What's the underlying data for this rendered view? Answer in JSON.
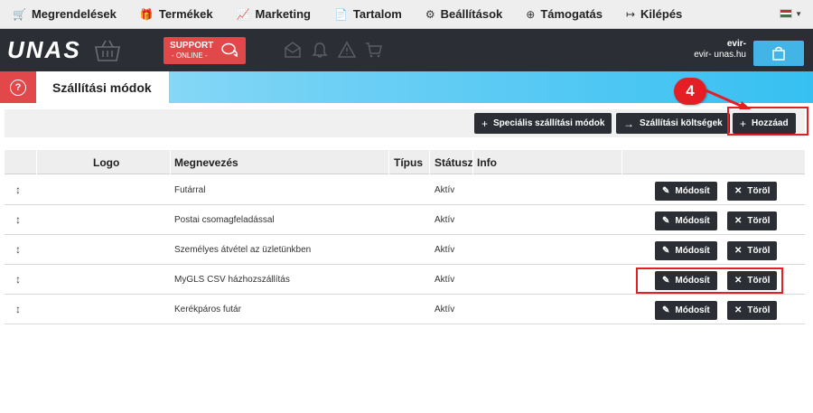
{
  "topmenu": {
    "items": [
      {
        "icon": "shopping-cart-icon",
        "glyph": "🛒",
        "label": "Megrendelések"
      },
      {
        "icon": "gift-icon",
        "glyph": "🎁",
        "label": "Termékek"
      },
      {
        "icon": "chart-line-icon",
        "glyph": "📈",
        "label": "Marketing"
      },
      {
        "icon": "document-icon",
        "glyph": "📄",
        "label": "Tartalom"
      },
      {
        "icon": "gear-icon",
        "glyph": "⚙",
        "label": "Beállítások"
      },
      {
        "icon": "lifebuoy-icon",
        "glyph": "⊕",
        "label": "Támogatás"
      },
      {
        "icon": "logout-icon",
        "glyph": "↦",
        "label": "Kilépés"
      }
    ],
    "language_flag": "hungarian-flag-icon"
  },
  "header": {
    "logo": "UNAS",
    "support_title": "SUPPORT",
    "support_subtitle": "- ONLINE -",
    "user_name": "evir-",
    "user_domain": "evir-        unas.hu"
  },
  "page": {
    "title": "Szállítási módok",
    "help_glyph": "?"
  },
  "toolbar": {
    "special_label": "Speciális szállítási módok",
    "costs_label": "Szállítási költségek",
    "add_label": "Hozzáad"
  },
  "table": {
    "columns": [
      "Logo",
      "Megnevezés",
      "Típus",
      "Státusz",
      "Info"
    ],
    "sort_glyph": "↕",
    "edit_label": "Módosít",
    "delete_label": "Töröl",
    "rows": [
      {
        "name": "Futárral",
        "status": "Aktív"
      },
      {
        "name": "Postai csomagfeladással",
        "status": "Aktív"
      },
      {
        "name": "Személyes átvétel az üzletünkben",
        "status": "Aktív"
      },
      {
        "name": "MyGLS CSV házhozszállítás",
        "status": "Aktív"
      },
      {
        "name": "Kerékpáros futár",
        "status": "Aktív"
      }
    ]
  },
  "annotation": {
    "step_number": "4"
  },
  "colors": {
    "accent_red": "#e2474a",
    "dark": "#2b2f35",
    "cyan": "#36c0f2",
    "highlight": "#e31e24"
  }
}
